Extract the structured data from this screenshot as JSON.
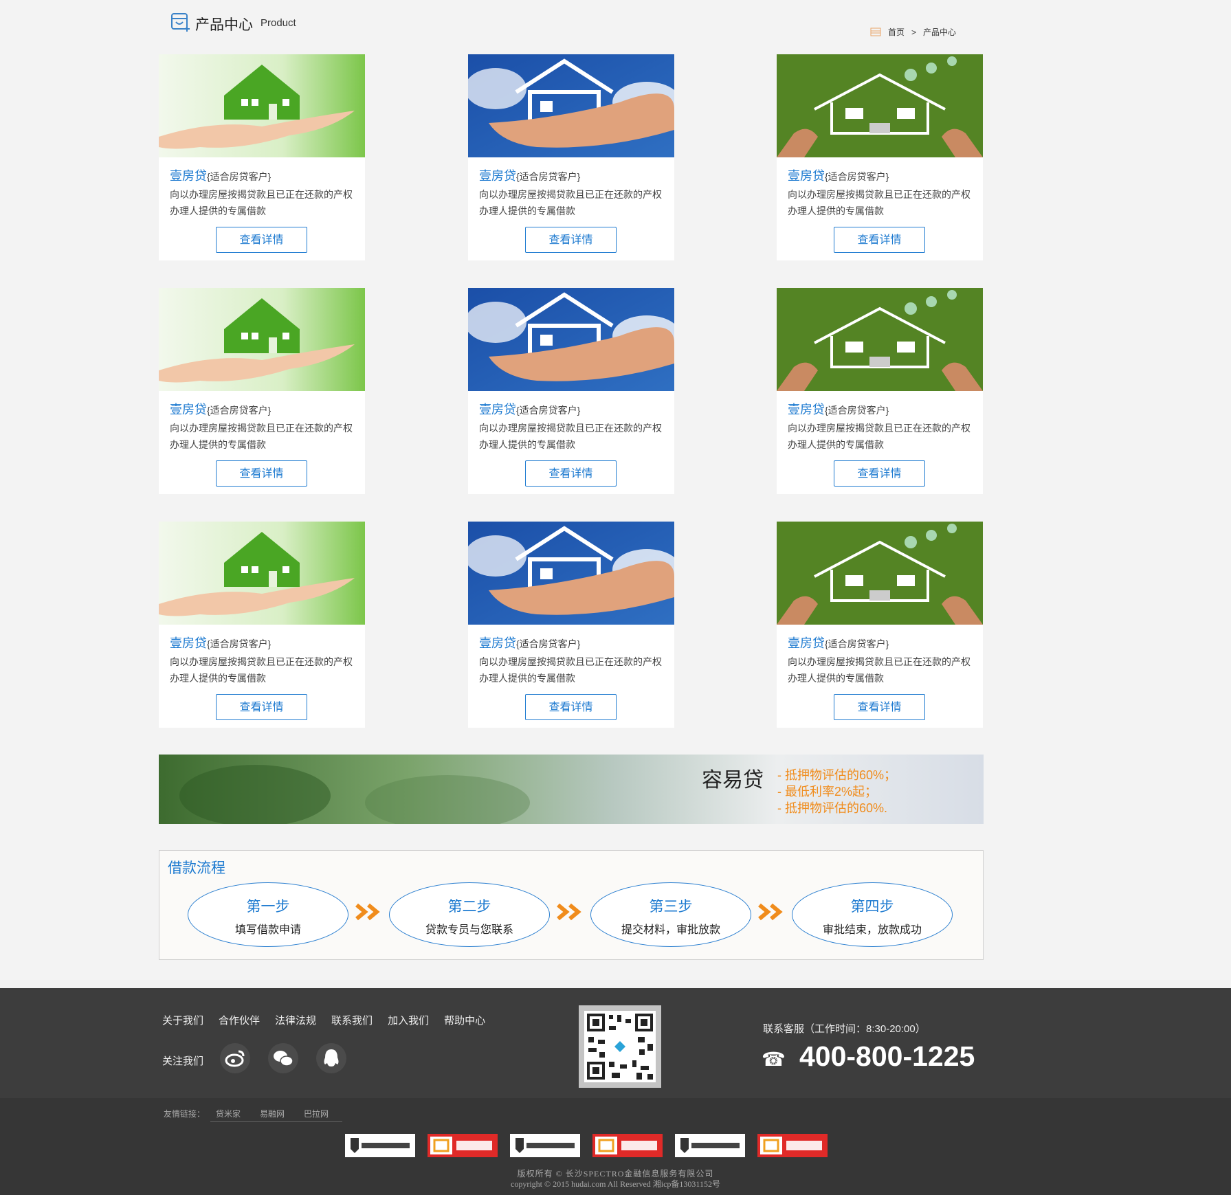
{
  "header": {
    "title": "产品中心",
    "subtitle": "Product"
  },
  "breadcrumb": {
    "home": "首页",
    "separator": ">",
    "current": "产品中心"
  },
  "product": {
    "name": "壹房贷",
    "tag": "{适合房贷客户}",
    "desc": "向以办理房屋按揭贷款且已正在还款的产权办理人提供的专属借款",
    "button": "查看详情"
  },
  "banner": {
    "title": "容易贷",
    "points": [
      "抵押物评估的60%；",
      "最低利率2%起；",
      "抵押物评估的60%."
    ]
  },
  "process": {
    "title": "借款流程",
    "steps": [
      {
        "label": "第一步",
        "text": "填写借款申请"
      },
      {
        "label": "第二步",
        "text": "贷款专员与您联系"
      },
      {
        "label": "第三步",
        "text": "提交材料，审批放款"
      },
      {
        "label": "第四步",
        "text": "审批结束，放款成功"
      }
    ]
  },
  "footer": {
    "nav": [
      "关于我们",
      "合作伙伴",
      "法律法规",
      "联系我们",
      "加入我们",
      "帮助中心"
    ],
    "follow": "关注我们",
    "service": "联系客服（工作时间：8:30-20:00）",
    "phone": "400-800-1225",
    "links_label": "友情链接：",
    "links": [
      "贷米家",
      "易融网",
      "巴拉网"
    ],
    "copyright1": "版权所有 © 长沙SPECTRO金融信息服务有限公司",
    "copyright2": "copyright © 2015 hudai.com All Reserved 湘icp备13031152号"
  },
  "colors": {
    "accent": "#1d7ad0",
    "orange": "#f08c1c",
    "footer": "#3d3d3d"
  }
}
